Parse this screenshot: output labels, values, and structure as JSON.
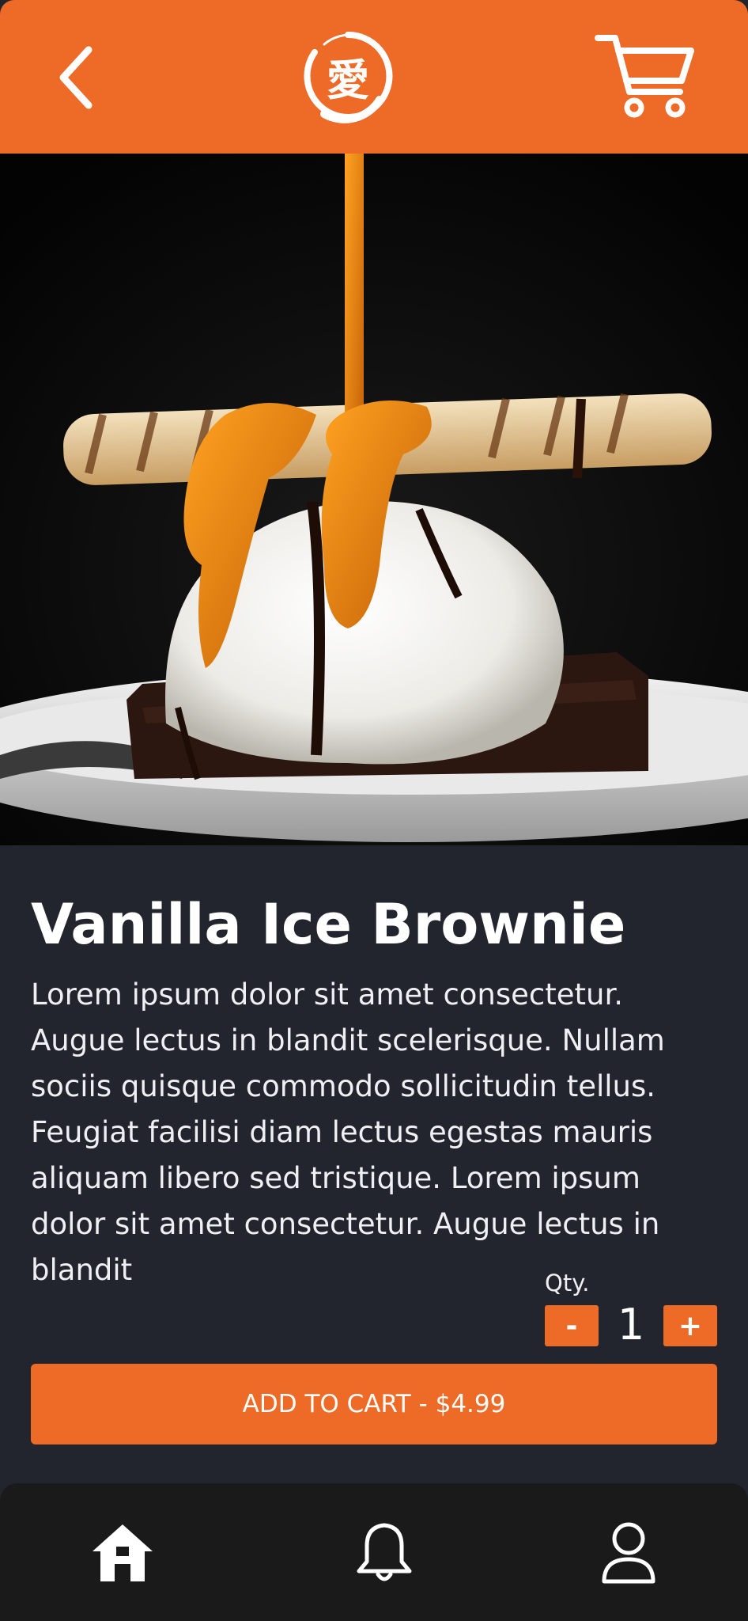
{
  "header": {
    "back_icon": "chevron-left-icon",
    "logo_glyph": "愛",
    "cart_icon": "shopping-cart-icon"
  },
  "product": {
    "image_alt": "Vanilla ice cream scoop on a brownie with caramel and chocolate drizzle and wafer roll",
    "title": "Vanilla Ice Brownie",
    "description": "Lorem ipsum dolor sit amet consectetur. Augue lectus in blandit scelerisque. Nullam sociis quisque commodo sollicitudin tellus. Feugiat facilisi diam lectus egestas mauris aliquam libero sed tristique. Lorem ipsum dolor sit amet consectetur. Augue lectus in blandit"
  },
  "quantity": {
    "label": "Qty.",
    "minus_label": "-",
    "value": "1",
    "plus_label": "+"
  },
  "cta": {
    "add_to_cart_label": "ADD TO CART - $4.99"
  },
  "bottom_nav": {
    "items": [
      {
        "icon": "home-icon",
        "active": true
      },
      {
        "icon": "bell-icon",
        "active": false
      },
      {
        "icon": "user-icon",
        "active": false
      }
    ]
  },
  "colors": {
    "accent": "#ee6a27",
    "background": "#22252d",
    "nav_background": "#1a1a1a",
    "text": "#ffffff"
  }
}
